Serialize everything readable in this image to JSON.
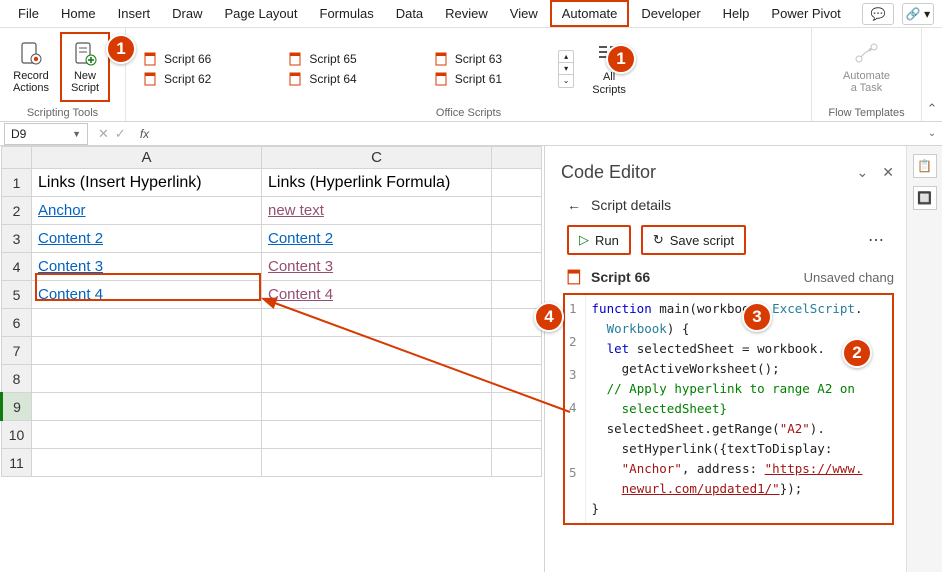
{
  "menubar": {
    "items": [
      "File",
      "Home",
      "Insert",
      "Draw",
      "Page Layout",
      "Formulas",
      "Data",
      "Review",
      "View",
      "Automate",
      "Developer",
      "Help",
      "Power Pivot"
    ],
    "active_index": 9
  },
  "ribbon": {
    "group1_label": "Scripting Tools",
    "record_actions": "Record\nActions",
    "new_script": "New\nScript",
    "group2_label": "Office Scripts",
    "scripts_col1": [
      "Script 66",
      "Script 62"
    ],
    "scripts_col2": [
      "Script 65",
      "Script 64"
    ],
    "scripts_col3": [
      "Script 63",
      "Script 61"
    ],
    "all_scripts": "All\nScripts",
    "group3_label": "Flow Templates",
    "automate_task": "Automate\na Task"
  },
  "namebox": {
    "value": "D9"
  },
  "grid": {
    "col_headers": [
      "A",
      "C"
    ],
    "row_headers": [
      "1",
      "2",
      "3",
      "4",
      "5",
      "6",
      "7",
      "8",
      "9",
      "10",
      "11"
    ],
    "header_a": "Links (Insert Hyperlink)",
    "header_c": "Links (Hyperlink Formula)",
    "a2": "Anchor",
    "c2": "new text",
    "a3": "Content 2",
    "c3": "Content 2",
    "a4": "Content 3",
    "c4": "Content 3",
    "a5": "Content 4",
    "c5": "Content 4"
  },
  "panel": {
    "title": "Code Editor",
    "breadcrumb": "Script details",
    "run_label": "Run",
    "save_label": "Save script",
    "script_name": "Script 66",
    "status": "Unsaved chang"
  },
  "code": {
    "line1a": "function",
    "line1b": " main(workbook: ",
    "line1c": "ExcelScript",
    "line1d": ".",
    "line1e": "Workbook",
    "line1f": ") {",
    "line2a": "  let",
    "line2b": " selectedSheet = workbook.",
    "line2c": "    getActiveWorksheet();",
    "line3a": "  // Apply hyperlink to range A2 on",
    "line3b": "    selectedSheet}",
    "line4a": "  selectedSheet.getRange(",
    "line4b": "\"A2\"",
    "line4c": ").",
    "line4d": "    setHyperlink({textToDisplay: ",
    "line4e": "\"Anchor\"",
    "line4f": ", address: ",
    "line4g": "\"https://www.",
    "line4h": "newurl.com/updated1/\"",
    "line4i": "});",
    "line5": "}"
  },
  "badges": {
    "b1a": "1",
    "b1b": "1",
    "b2": "2",
    "b3": "3",
    "b4": "4"
  }
}
